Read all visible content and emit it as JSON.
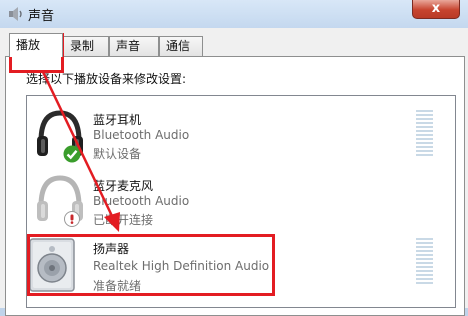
{
  "window": {
    "title": "声音",
    "close_label": "x"
  },
  "tabs": [
    {
      "label": "播放",
      "active": true
    },
    {
      "label": "录制",
      "active": false
    },
    {
      "label": "声音",
      "active": false
    },
    {
      "label": "通信",
      "active": false
    }
  ],
  "instruction": "选择以下播放设备来修改设置:",
  "devices": [
    {
      "name": "蓝牙耳机",
      "type": "Bluetooth Audio",
      "status": "默认设备",
      "icon": "headphones-icon",
      "badge": "green-checkmark"
    },
    {
      "name": "蓝牙麦克风",
      "type": "Bluetooth Audio",
      "status": "已断开连接",
      "icon": "headphones-icon",
      "badge": "red-disconnected"
    },
    {
      "name": "扬声器",
      "type": "Realtek High Definition Audio",
      "status": "准备就绪",
      "icon": "speaker-icon",
      "badge": ""
    }
  ],
  "annotation_color": "#e31c22"
}
